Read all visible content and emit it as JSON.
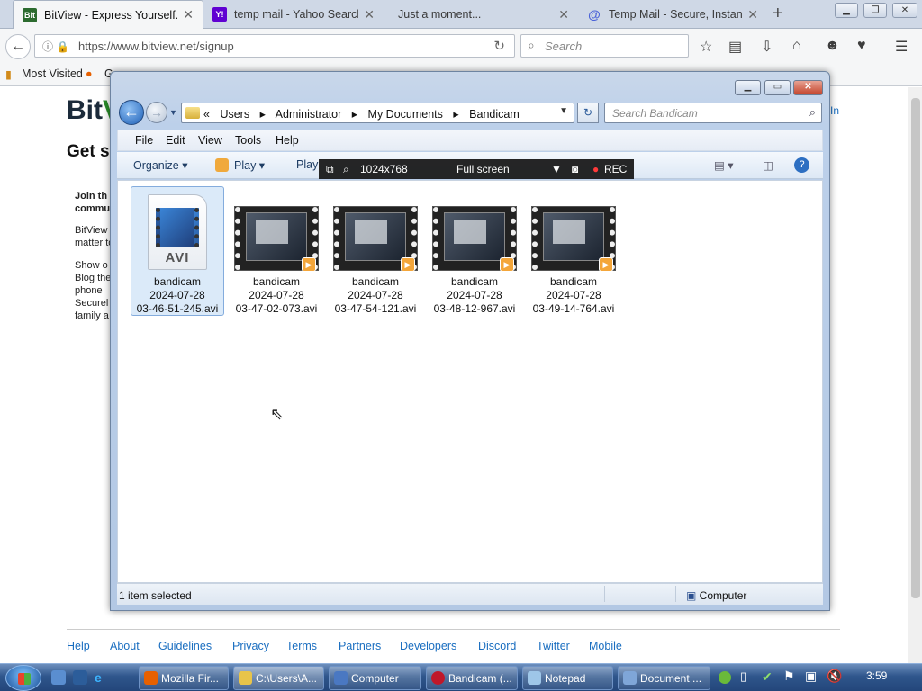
{
  "browser": {
    "tabs": [
      {
        "title": "BitView - Express Yourself.",
        "active": true,
        "favicon": "bitview-icon"
      },
      {
        "title": "temp mail - Yahoo Search ...",
        "active": false,
        "favicon": "yahoo-icon"
      },
      {
        "title": "Just a moment...",
        "active": false,
        "favicon": ""
      },
      {
        "title": "Temp Mail - Secure, Instan...",
        "active": false,
        "favicon": "tempmail-icon"
      }
    ],
    "new_tab": "+",
    "url": "https://www.bitview.net/signup",
    "search_placeholder": "Search",
    "bookmarks": [
      "Most Visited",
      "G"
    ]
  },
  "page": {
    "logo_bit": "Bit",
    "logo_v": "V",
    "heading": "Get s",
    "side_lines": [
      "Join th",
      "commu",
      "BitView",
      "matter to",
      "Show o",
      "Blog the",
      "phone",
      "Securel",
      "family a"
    ],
    "signin": "In",
    "footer_links": [
      "Help",
      "About",
      "Guidelines",
      "Privacy",
      "Terms",
      "Partners",
      "Developers",
      "Discord",
      "Twitter",
      "Mobile"
    ]
  },
  "explorer": {
    "breadcrumb": [
      "«",
      "Users",
      "▸",
      "Administrator",
      "▸",
      "My Documents",
      "▸",
      "Bandicam"
    ],
    "search_placeholder": "Search Bandicam",
    "menu": [
      "File",
      "Edit",
      "View",
      "Tools",
      "Help"
    ],
    "commands": {
      "organize": "Organize ▾",
      "play": "Play ▾",
      "play2": "Play"
    },
    "files": [
      {
        "name": "bandicam",
        "date": "2024-07-28",
        "time": "03-46-51-245.avi",
        "selected": true,
        "kind": "avi-icon"
      },
      {
        "name": "bandicam",
        "date": "2024-07-28",
        "time": "03-47-02-073.avi",
        "selected": false,
        "kind": "thumbnail"
      },
      {
        "name": "bandicam",
        "date": "2024-07-28",
        "time": "03-47-54-121.avi",
        "selected": false,
        "kind": "thumbnail"
      },
      {
        "name": "bandicam",
        "date": "2024-07-28",
        "time": "03-48-12-967.avi",
        "selected": false,
        "kind": "thumbnail"
      },
      {
        "name": "bandicam",
        "date": "2024-07-28",
        "time": "03-49-14-764.avi",
        "selected": false,
        "kind": "thumbnail"
      }
    ],
    "avi_label": "AVI",
    "status_left": "1 item selected",
    "status_right": "Computer"
  },
  "bandicam_bar": {
    "size": "1024x768",
    "mode": "Full screen",
    "rec": "REC"
  },
  "taskbar": {
    "buttons": [
      {
        "label": "Mozilla Fir...",
        "color": "#e66000"
      },
      {
        "label": "C:\\Users\\A...",
        "color": "#e8c44a"
      },
      {
        "label": "Computer",
        "color": "#4a78c2"
      },
      {
        "label": "Bandicam (...",
        "color": "#c0182a"
      },
      {
        "label": "Notepad",
        "color": "#9ec6e8"
      },
      {
        "label": "Document ...",
        "color": "#7fa6d8"
      }
    ],
    "clock": "3:59"
  },
  "colors": {
    "accent": "#1a6ec0",
    "selection": "#dbeaf9",
    "taskbar": "#2f568c"
  }
}
